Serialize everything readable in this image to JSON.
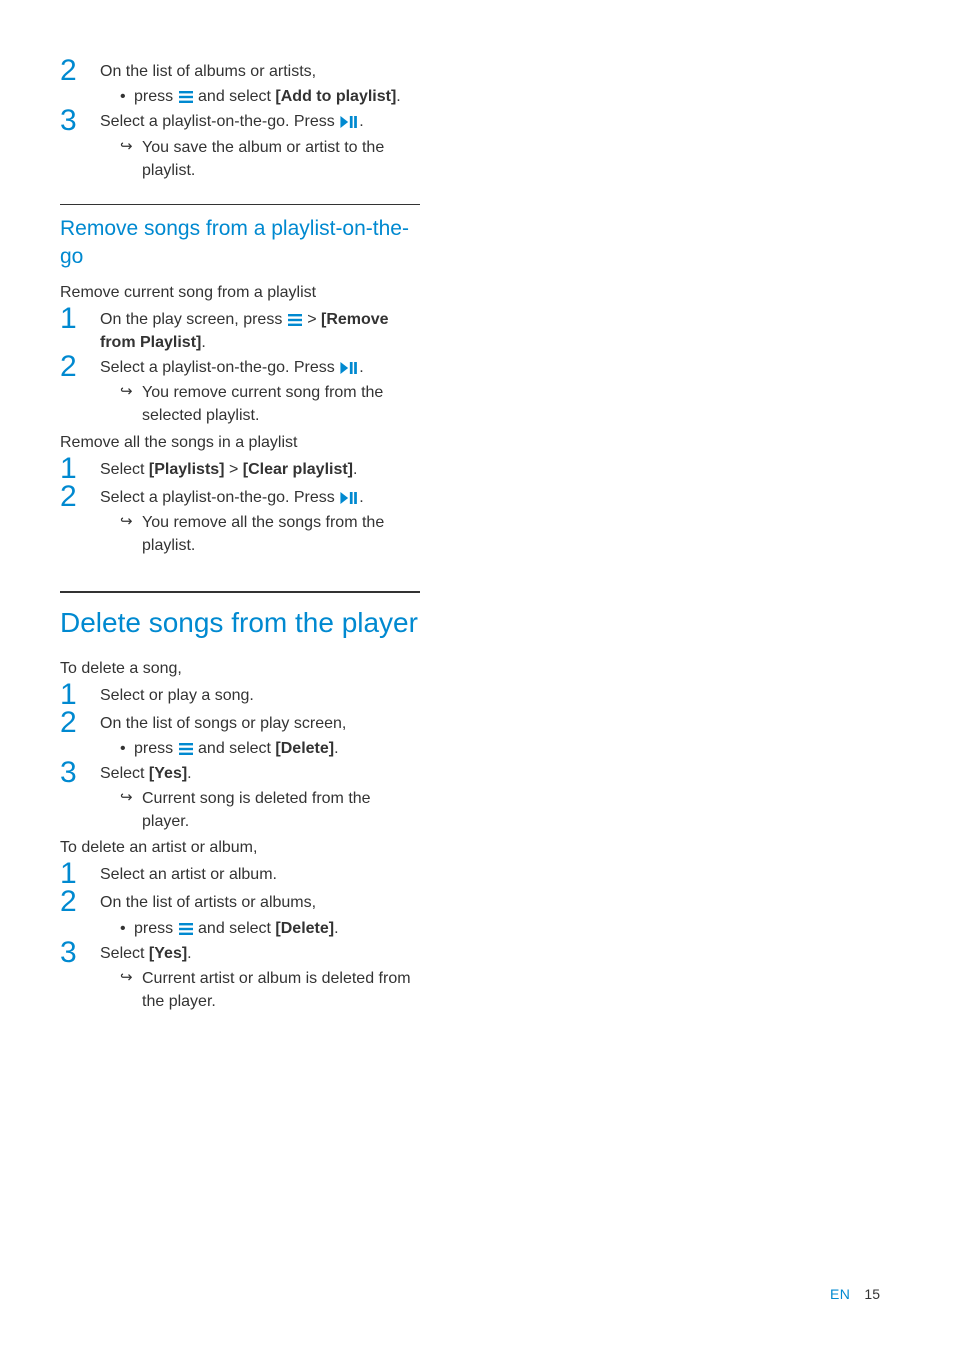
{
  "section_a": {
    "step2": {
      "num": "2",
      "line": "On the list of albums or artists,",
      "bullet_pre": "press ",
      "bullet_post": " and select ",
      "bullet_bold": "[Add to playlist]",
      "bullet_end": "."
    },
    "step3": {
      "num": "3",
      "line_pre": "Select a playlist-on-the-go. Press ",
      "line_post": ".",
      "result": "You save the album or artist to the playlist."
    }
  },
  "remove": {
    "heading": "Remove songs from a playlist-on-the-go",
    "part1": {
      "lead": "Remove current song from a playlist",
      "step1": {
        "num": "1",
        "pre": "On the play screen, press ",
        "mid": " > ",
        "bold": "[Remove from Playlist]",
        "end": "."
      },
      "step2": {
        "num": "2",
        "pre": "Select a playlist-on-the-go. Press ",
        "post": ".",
        "result": "You remove current song from the selected playlist."
      }
    },
    "part2": {
      "lead": "Remove all the songs in a playlist",
      "step1": {
        "num": "1",
        "pre": "Select ",
        "b1": "[Playlists]",
        "mid": " > ",
        "b2": "[Clear playlist]",
        "end": "."
      },
      "step2": {
        "num": "2",
        "pre": "Select a playlist-on-the-go. Press ",
        "post": ".",
        "result": "You remove all the songs from the playlist."
      }
    }
  },
  "delete": {
    "heading": "Delete songs from the player",
    "part1": {
      "lead": "To delete a song,",
      "step1": {
        "num": "1",
        "text": "Select or play a song."
      },
      "step2": {
        "num": "2",
        "line": "On the list of songs or play screen,",
        "bullet_pre": "press ",
        "bullet_post": " and select ",
        "bullet_bold": "[Delete]",
        "bullet_end": "."
      },
      "step3": {
        "num": "3",
        "pre": "Select ",
        "bold": "[Yes]",
        "end": ".",
        "result": "Current song is deleted from the player."
      }
    },
    "part2": {
      "lead": "To delete an artist or album,",
      "step1": {
        "num": "1",
        "text": "Select an artist or album."
      },
      "step2": {
        "num": "2",
        "line": "On the list of artists or albums,",
        "bullet_pre": "press ",
        "bullet_post": " and select ",
        "bullet_bold": "[Delete]",
        "bullet_end": "."
      },
      "step3": {
        "num": "3",
        "pre": "Select ",
        "bold": "[Yes]",
        "end": ".",
        "result": "Current artist or album is deleted from the player."
      }
    }
  },
  "footer": {
    "lang": "EN",
    "page": "15"
  }
}
